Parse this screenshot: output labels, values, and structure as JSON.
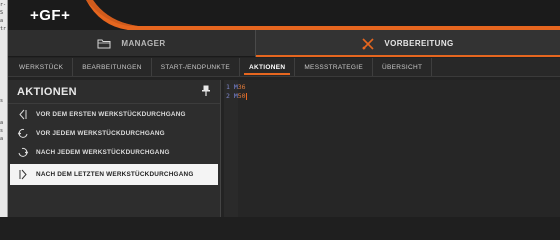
{
  "brand": {
    "logo_text": "+GF+",
    "accent_color": "#e6661f"
  },
  "modes": [
    {
      "label": "MANAGER",
      "icon": "folder-icon",
      "active": false
    },
    {
      "label": "VORBEREITUNG",
      "icon": "tools-icon",
      "active": true
    }
  ],
  "subtabs": [
    "WERKSTÜCK",
    "BEARBEITUNGEN",
    "START-/ENDPUNKTE",
    "AKTIONEN",
    "MESSSTRATEGIE",
    "ÜBERSICHT"
  ],
  "active_subtab": "AKTIONEN",
  "panel": {
    "title": "AKTIONEN",
    "pin_icon": "pin-icon",
    "items": [
      {
        "label": "VOR DEM ERSTEN WERKSTÜCKDURCHGANG",
        "icon": "bracket-left-icon"
      },
      {
        "label": "VOR JEDEM WERKSTÜCKDURCHGANG",
        "icon": "loop-left-icon"
      },
      {
        "label": "NACH JEDEM WERKSTÜCKDURCHGANG",
        "icon": "loop-right-icon"
      },
      {
        "label": "NACH DEM LETZTEN WERKSTÜCKDURCHGANG",
        "icon": "bracket-right-icon",
        "selected": true
      }
    ]
  },
  "editor": {
    "lines": [
      {
        "num": "1",
        "code": "M",
        "value": "36"
      },
      {
        "num": "2",
        "code": "M",
        "value": "50"
      }
    ]
  },
  "sliver": {
    "chars": [
      "r-",
      "S",
      "a",
      "tr",
      "",
      "",
      "",
      "",
      "",
      "",
      "",
      "",
      "s",
      "a",
      "s",
      "a"
    ]
  }
}
